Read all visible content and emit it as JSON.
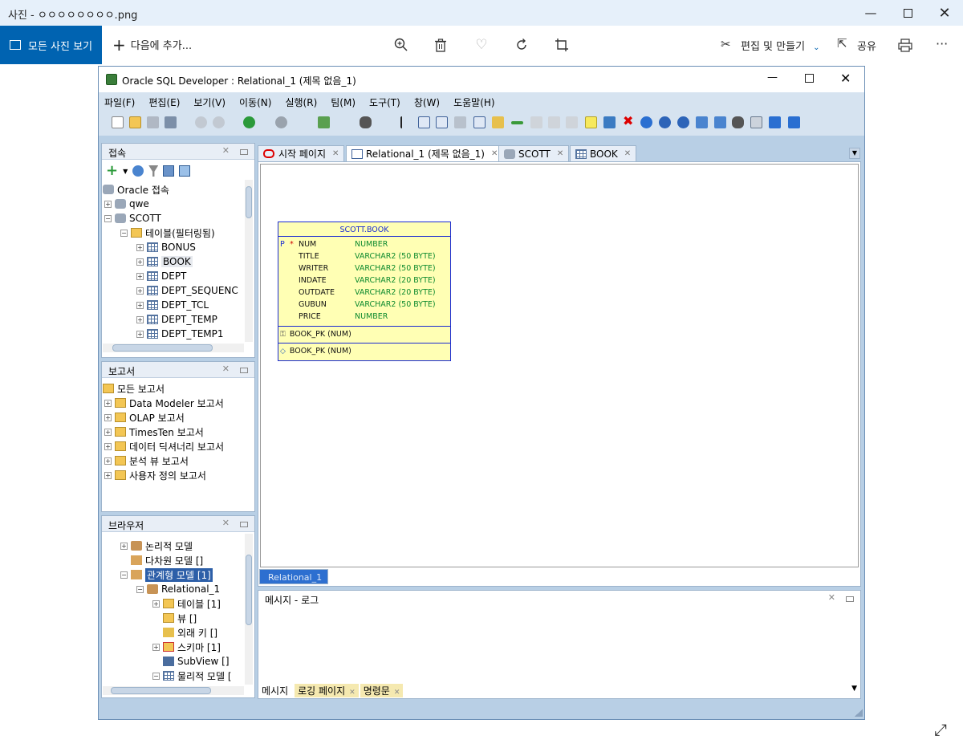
{
  "photos": {
    "title": "사진 - ㅇㅇㅇㅇㅇㅇㅇㅇ.png",
    "view_all": "모든 사진 보기",
    "add_to": "다음에 추가...",
    "edit_create": "편집 및 만들기",
    "share": "공유",
    "more": "···"
  },
  "window": {
    "title": "Oracle SQL Developer : Relational_1 (제목 없음_1)"
  },
  "menu": [
    "파일(F)",
    "편집(E)",
    "보기(V)",
    "이동(N)",
    "실행(R)",
    "팀(M)",
    "도구(T)",
    "창(W)",
    "도움말(H)"
  ],
  "connections": {
    "title": "접속",
    "root": "Oracle 접속",
    "items": [
      "qwe",
      "SCOTT"
    ],
    "tables_folder": "테이블(필터링됨)",
    "tables": [
      "BONUS",
      "BOOK",
      "DEPT",
      "DEPT_SEQUENC",
      "DEPT_TCL",
      "DEPT_TEMP",
      "DEPT_TEMP1"
    ]
  },
  "reports": {
    "title": "보고서",
    "root": "모든 보고서",
    "items": [
      "Data Modeler 보고서",
      "OLAP 보고서",
      "TimesTen 보고서",
      "데이터 딕셔너리 보고서",
      "분석 뷰 보고서",
      "사용자 정의 보고서"
    ]
  },
  "browser": {
    "title": "브라우저",
    "items": [
      "논리적 모델",
      "다차원 모델 []",
      "관계형 모델 [1]",
      "Relational_1",
      "테이블 [1]",
      "뷰 []",
      "외래 키 []",
      "스키마 [1]",
      "SubView []",
      "물리적 모델 ["
    ]
  },
  "tabs": [
    "시작 페이지",
    "Relational_1 (제목 없음_1)",
    "SCOTT",
    "BOOK"
  ],
  "entity": {
    "title": "SCOTT.BOOK",
    "pk_marker": "P",
    "req_marker": "*",
    "columns": [
      {
        "name": "NUM",
        "type": "NUMBER"
      },
      {
        "name": "TITLE",
        "type": "VARCHAR2 (50 BYTE)"
      },
      {
        "name": "WRITER",
        "type": "VARCHAR2 (50 BYTE)"
      },
      {
        "name": "INDATE",
        "type": "VARCHAR2 (20 BYTE)"
      },
      {
        "name": "OUTDATE",
        "type": "VARCHAR2 (20 BYTE)"
      },
      {
        "name": "GUBUN",
        "type": "VARCHAR2 (50 BYTE)"
      },
      {
        "name": "PRICE",
        "type": "NUMBER"
      }
    ],
    "pk_constraint": "BOOK_PK (NUM)",
    "index": "BOOK_PK (NUM)"
  },
  "diagram_tab": "Relational_1",
  "log": {
    "title": "메시지 - 로그",
    "tabs": [
      "메시지",
      "로깅 페이지",
      "명령문"
    ]
  }
}
